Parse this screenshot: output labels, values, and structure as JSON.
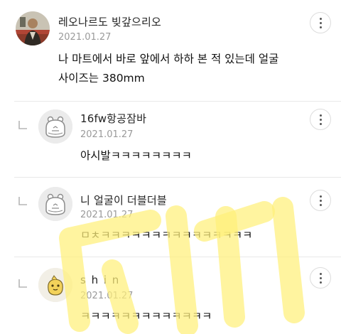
{
  "comments": [
    {
      "author": "레오나르도 빚갚으리오",
      "date": "2021.01.27",
      "text_line1": "나 마트에서 바로 앞에서 하하 본 적 있는데 얼굴",
      "text_line2": "사이즈는 380mm",
      "is_reply": false,
      "avatar": "photo-avatar"
    },
    {
      "author": "16fw항공잠바",
      "date": "2021.01.27",
      "text": "아시발ㅋㅋㅋㅋㅋㅋㅋㅋ",
      "is_reply": true,
      "avatar": "default-hippo-avatar"
    },
    {
      "author": "니 얼굴이 더블더블",
      "date": "2021.01.27",
      "text": "ㅁㅊㅋㅋㅋㅋㅋㅋㅋㅋㅋㅋㅋㅋㅋㅋㅋ",
      "is_reply": true,
      "avatar": "default-hippo-avatar"
    },
    {
      "author": "s h i n",
      "date": "2021.01.27",
      "text": "ㅋㅋㅋㅋㅋㅋㅋㅋㅋㅋㅋㅋㅋ",
      "is_reply": true,
      "avatar": "yellow-character-avatar"
    }
  ],
  "icons": {
    "more": "more-vertical-icon",
    "reply": "reply-indent-icon"
  },
  "colors": {
    "date": "#9a9a9a",
    "divider": "#e8e8e8",
    "watermark": "#fff2a0"
  }
}
